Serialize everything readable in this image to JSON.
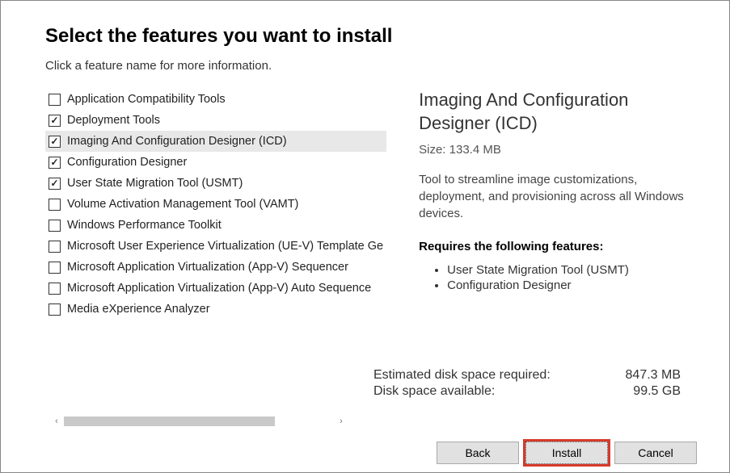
{
  "heading": "Select the features you want to install",
  "subtitle": "Click a feature name for more information.",
  "features": [
    {
      "label": "Application Compatibility Tools",
      "checked": false
    },
    {
      "label": "Deployment Tools",
      "checked": true
    },
    {
      "label": "Imaging And Configuration Designer (ICD)",
      "checked": true,
      "selected": true
    },
    {
      "label": "Configuration Designer",
      "checked": true
    },
    {
      "label": "User State Migration Tool (USMT)",
      "checked": true
    },
    {
      "label": "Volume Activation Management Tool (VAMT)",
      "checked": false
    },
    {
      "label": "Windows Performance Toolkit",
      "checked": false
    },
    {
      "label": "Microsoft User Experience Virtualization (UE-V) Template Ge",
      "checked": false
    },
    {
      "label": "Microsoft Application Virtualization (App-V) Sequencer",
      "checked": false
    },
    {
      "label": "Microsoft Application Virtualization (App-V) Auto Sequence",
      "checked": false
    },
    {
      "label": "Media eXperience Analyzer",
      "checked": false
    }
  ],
  "detail": {
    "title": "Imaging And Configuration Designer (ICD)",
    "size_label": "Size: 133.4 MB",
    "description": "Tool to streamline image customizations, deployment, and provisioning across all Windows devices.",
    "requires_heading": "Requires the following features:",
    "requires": [
      "User State Migration Tool (USMT)",
      "Configuration Designer"
    ]
  },
  "disk": {
    "required_label": "Estimated disk space required:",
    "required_value": "847.3 MB",
    "available_label": "Disk space available:",
    "available_value": "99.5 GB"
  },
  "buttons": {
    "back": "Back",
    "install": "Install",
    "cancel": "Cancel"
  }
}
